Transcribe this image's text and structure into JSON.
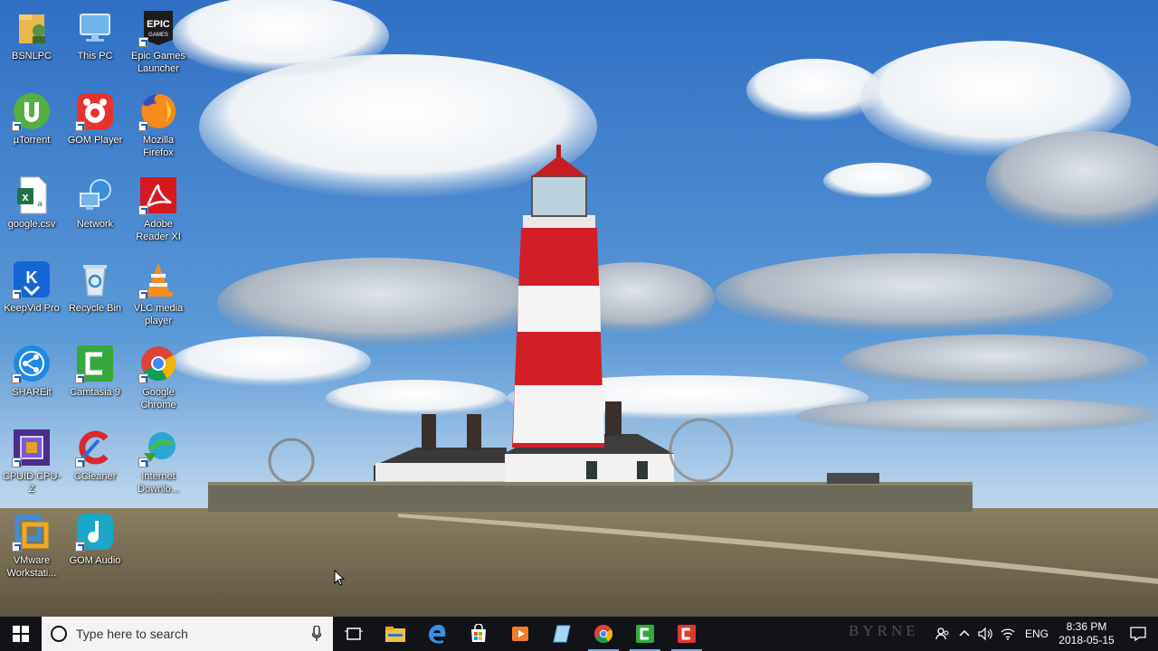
{
  "desktop": {
    "icons": [
      {
        "label": "BSNLPC",
        "icon": "user-folder-icon"
      },
      {
        "label": "This PC",
        "icon": "computer-icon"
      },
      {
        "label": "Epic Games Launcher",
        "icon": "epic-games-icon"
      },
      {
        "label": "µTorrent",
        "icon": "utorrent-icon"
      },
      {
        "label": "GOM Player",
        "icon": "gom-player-icon"
      },
      {
        "label": "Mozilla Firefox",
        "icon": "firefox-icon"
      },
      {
        "label": "google.csv",
        "icon": "excel-file-icon"
      },
      {
        "label": "Network",
        "icon": "network-icon"
      },
      {
        "label": "Adobe Reader XI",
        "icon": "adobe-reader-icon"
      },
      {
        "label": "KeepVid Pro",
        "icon": "keepvid-icon"
      },
      {
        "label": "Recycle Bin",
        "icon": "recycle-bin-icon"
      },
      {
        "label": "VLC media player",
        "icon": "vlc-icon"
      },
      {
        "label": "SHAREit",
        "icon": "shareit-icon"
      },
      {
        "label": "Camtasia 9",
        "icon": "camtasia-icon"
      },
      {
        "label": "Google Chrome",
        "icon": "chrome-icon"
      },
      {
        "label": "CPUID CPU-Z",
        "icon": "cpuz-icon"
      },
      {
        "label": "CCleaner",
        "icon": "ccleaner-icon"
      },
      {
        "label": "Internet Downlo...",
        "icon": "idm-icon"
      },
      {
        "label": "VMware Workstati...",
        "icon": "vmware-icon"
      },
      {
        "label": "GOM Audio",
        "icon": "gom-audio-icon"
      }
    ]
  },
  "taskbar": {
    "search_placeholder": "Type here to search",
    "pinned": [
      "task-view-icon",
      "file-explorer-icon",
      "edge-icon",
      "store-icon",
      "media-player-icon",
      "notes-icon",
      "chrome-icon",
      "camtasia-icon",
      "camtasia-recorder-icon"
    ],
    "tray": {
      "language": "ENG",
      "time": "8:36 PM",
      "date": "2018-05-15",
      "watermark": "BYRNE"
    }
  },
  "colors": {
    "taskbar_bg": "#111318",
    "sky": "#3b7fd0",
    "lighthouse_red": "#d21f26"
  }
}
